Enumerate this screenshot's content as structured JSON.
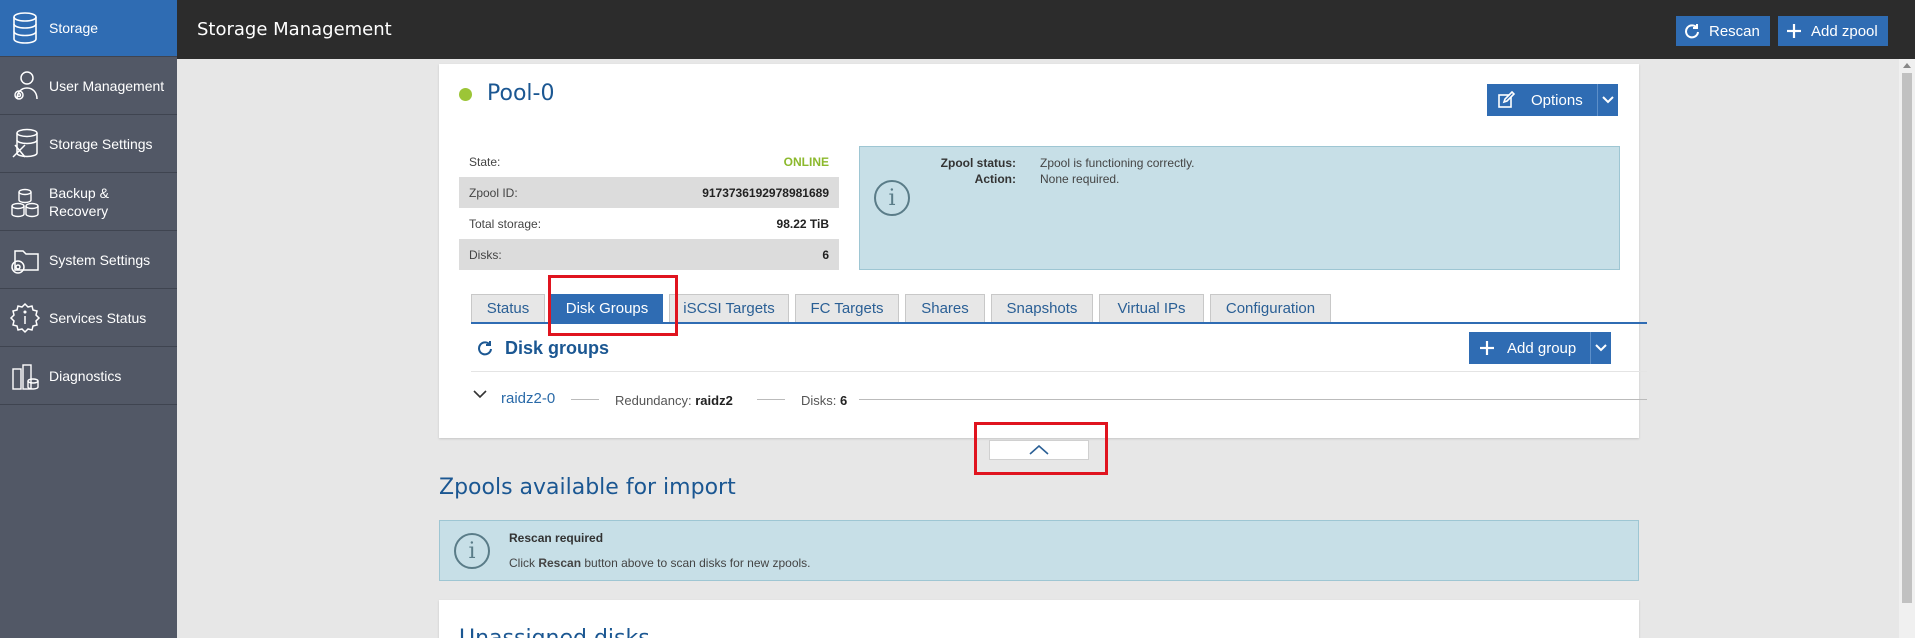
{
  "sidebar": {
    "items": [
      {
        "label": "Storage",
        "icon": "database-icon",
        "active": true
      },
      {
        "label": "User Management",
        "icon": "user-gear-icon"
      },
      {
        "label": "Storage Settings",
        "icon": "database-tools-icon"
      },
      {
        "label": "Backup & Recovery",
        "icon": "backup-disks-icon"
      },
      {
        "label": "System Settings",
        "icon": "folder-gear-icon"
      },
      {
        "label": "Services Status",
        "icon": "info-gear-icon"
      },
      {
        "label": "Diagnostics",
        "icon": "diagnostics-icon"
      }
    ]
  },
  "header": {
    "title": "Storage Management",
    "rescan_label": "Rescan",
    "add_zpool_label": "Add zpool"
  },
  "pool": {
    "name": "Pool-0",
    "status_color": "#9cc537",
    "options_label": "Options",
    "info": [
      {
        "key": "State:",
        "value": "ONLINE"
      },
      {
        "key": "Zpool ID:",
        "value": "9173736192978981689"
      },
      {
        "key": "Total storage:",
        "value": "98.22 TiB"
      },
      {
        "key": "Disks:",
        "value": "6"
      }
    ],
    "zpool_status_label": "Zpool status:",
    "zpool_status_value": "Zpool is functioning correctly.",
    "action_label": "Action:",
    "action_value": "None required."
  },
  "tabs": [
    {
      "label": "Status"
    },
    {
      "label": "Disk Groups",
      "active": true
    },
    {
      "label": "iSCSI Targets"
    },
    {
      "label": "FC Targets"
    },
    {
      "label": "Shares"
    },
    {
      "label": "Snapshots"
    },
    {
      "label": "Virtual IPs"
    },
    {
      "label": "Configuration"
    }
  ],
  "disk_groups": {
    "title": "Disk groups",
    "add_group_label": "Add group",
    "group": {
      "name": "raidz2-0",
      "redundancy_label": "Redundancy:",
      "redundancy_value": "raidz2",
      "disks_label": "Disks:",
      "disks_value": "6"
    }
  },
  "import_section": {
    "title": "Zpools available for import",
    "notice_title": "Rescan required",
    "notice_text_before": "Click ",
    "notice_text_bold": "Rescan",
    "notice_text_after": " button above to scan disks for new zpools."
  },
  "unassigned": {
    "title": "Unassigned disks"
  },
  "colors": {
    "accent": "#2f6cb3",
    "sidebar": "#525866",
    "topbar": "#2c2c2c",
    "highlight": "#e0141f"
  }
}
